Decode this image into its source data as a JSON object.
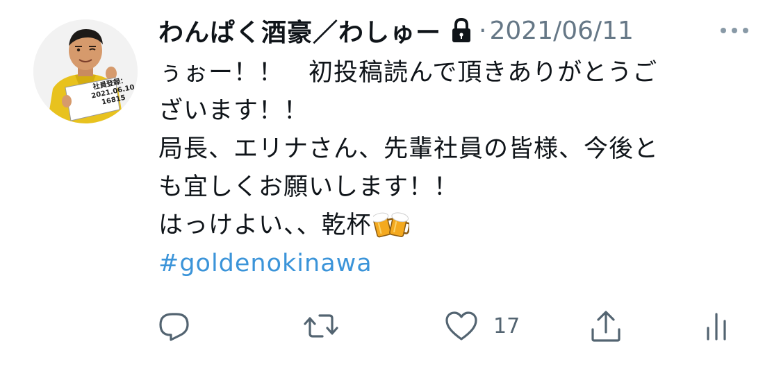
{
  "tweet": {
    "author": {
      "display_name": "わんぱく酒豪／わしゅー",
      "avatar_sign": {
        "line1": "社員登録：",
        "line2": "2021.06.10",
        "line3": "16815"
      },
      "icons": {
        "lock": "lock-icon"
      }
    },
    "separator": "·",
    "date": "2021/06/11",
    "body": {
      "line1": "ぅぉー！！　初投稿読んで頂きありがとうご",
      "line2": "ざいます！！",
      "line3": "局長、エリナさん、先輩社員の皆様、今後と",
      "line4": "も宜しくお願いします！！",
      "line5": "はっけよい、、乾杯",
      "emoji": "beer-mugs-emoji",
      "hashtag": "#goldenokinawa"
    },
    "actions": {
      "reply_icon": "reply-icon",
      "retweet_icon": "retweet-icon",
      "like_icon": "heart-icon",
      "like_count": "17",
      "share_icon": "share-icon",
      "analytics_icon": "analytics-icon"
    },
    "colors": {
      "text": "#0f1419",
      "muted": "#657786",
      "link": "#3b94d9",
      "icon": "#536471"
    }
  }
}
